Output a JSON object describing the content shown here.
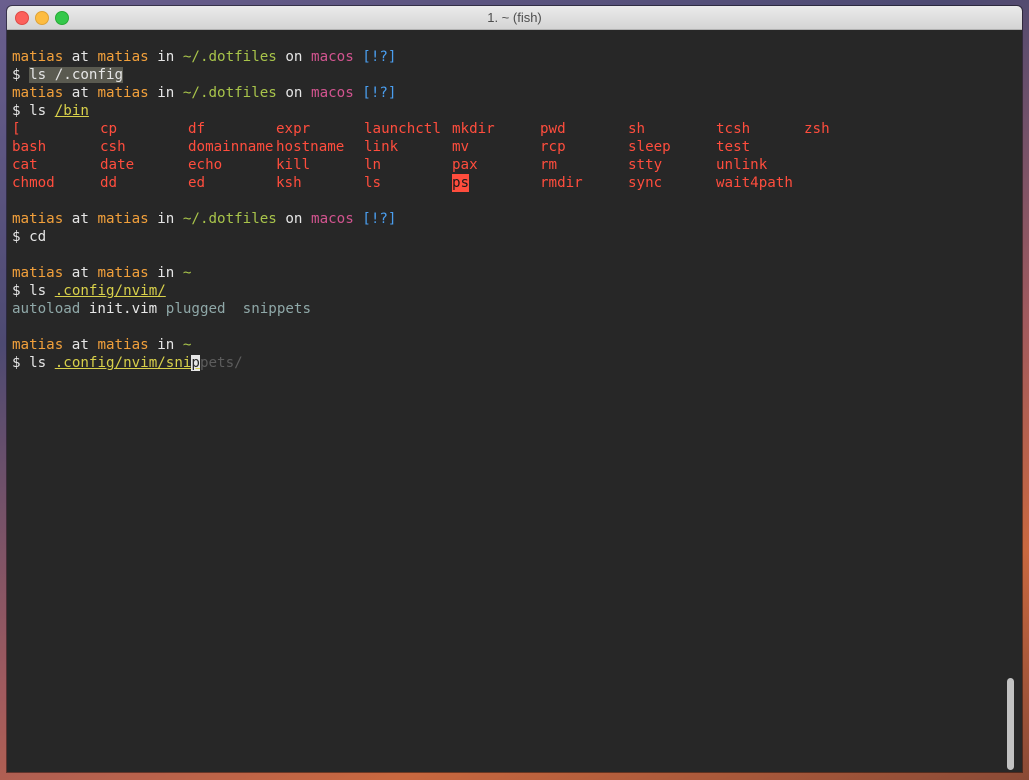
{
  "window": {
    "title": "1. ~ (fish)"
  },
  "prompt": {
    "user": "matias",
    "at": "at",
    "host": "matias",
    "in": "in",
    "on": "on",
    "branch": "macos",
    "flags": "[!?]",
    "dollar": "$"
  },
  "blocks": [
    {
      "dir": "~/.dotfiles",
      "cmd": "ls",
      "arg": "/.config",
      "has_branch": true
    },
    {
      "dir": "~/.dotfiles",
      "cmd": "ls",
      "arg": "/bin",
      "has_branch": true
    },
    {
      "dir": "~/.dotfiles",
      "cmd": "cd",
      "has_branch": true
    },
    {
      "dir": "~",
      "cmd": "ls",
      "arg": ".config/nvim/",
      "has_branch": false
    },
    {
      "dir": "~",
      "cmd": "ls",
      "arg_typed": ".config/nvim/sni",
      "arg_cursor": "p",
      "arg_ghost": "pets/",
      "has_branch": false
    }
  ],
  "bin_listing": [
    [
      "[",
      "cp",
      "df",
      "expr",
      "launchctl",
      "mkdir",
      "pwd",
      "sh",
      "tcsh",
      "zsh"
    ],
    [
      "bash",
      "csh",
      "domainname",
      "hostname",
      "link",
      "mv",
      "rcp",
      "sleep",
      "test"
    ],
    [
      "cat",
      "date",
      "echo",
      "kill",
      "ln",
      "pax",
      "rm",
      "stty",
      "unlink"
    ],
    [
      "chmod",
      "dd",
      "ed",
      "ksh",
      "ls",
      "ps",
      "rmdir",
      "sync",
      "wait4path"
    ]
  ],
  "nvim_listing": [
    {
      "name": "autoload",
      "kind": "dir"
    },
    {
      "name": "init.vim",
      "kind": "file"
    },
    {
      "name": "plugged",
      "kind": "dir"
    },
    {
      "name": "snippets",
      "kind": "dir"
    }
  ],
  "colors": {
    "bin_fg": "#ff4d3d",
    "user": "#f2a03b",
    "path": "#a8c44a",
    "branch": "#d2548f",
    "flags": "#4a9eef"
  }
}
